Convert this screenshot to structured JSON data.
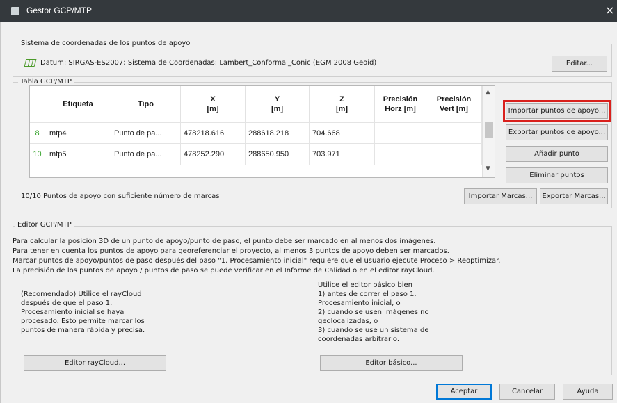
{
  "window": {
    "title": "Gestor GCP/MTP",
    "close_icon": "×"
  },
  "coord_system": {
    "group_title": "Sistema de coordenadas de los puntos de apoyo",
    "datum_text": "Datum: SIRGAS-ES2007; Sistema de Coordenadas: Lambert_Conformal_Conic (EGM 2008 Geoid)",
    "edit_button": "Editar..."
  },
  "table_group": {
    "group_title": "Tabla GCP/MTP",
    "columns": [
      {
        "line1": "",
        "line2": ""
      },
      {
        "line1": "Etiqueta",
        "line2": ""
      },
      {
        "line1": "Tipo",
        "line2": ""
      },
      {
        "line1": "X",
        "line2": "[m]"
      },
      {
        "line1": "Y",
        "line2": "[m]"
      },
      {
        "line1": "Z",
        "line2": "[m]"
      },
      {
        "line1": "Precisión",
        "line2": "Horz [m]"
      },
      {
        "line1": "Precisión",
        "line2": "Vert [m]"
      }
    ],
    "rows": [
      {
        "idx": "8",
        "label": "mtp4",
        "type": "Punto de pa...",
        "x": "478218.616",
        "y": "288618.218",
        "z": "704.668",
        "hacc": "",
        "vacc": ""
      },
      {
        "idx": "10",
        "label": "mtp5",
        "type": "Punto de pa...",
        "x": "478252.290",
        "y": "288650.950",
        "z": "703.971",
        "hacc": "",
        "vacc": ""
      }
    ],
    "side_buttons": {
      "import_points": "Importar puntos de apoyo...",
      "export_points": "Exportar puntos de apoyo...",
      "add_point": "Añadir punto",
      "remove_points": "Eliminar puntos"
    },
    "status": "10/10 Puntos de apoyo con suficiente número de marcas",
    "import_marks": "Importar Marcas...",
    "export_marks": "Exportar Marcas..."
  },
  "editor": {
    "group_title": "Editor GCP/MTP",
    "lines": [
      "Para calcular la posición 3D de un punto de apoyo/punto de paso, el punto debe ser marcado en al menos dos imágenes.",
      "Para tener en cuenta los puntos de apoyo para georeferenciar el proyecto, al menos 3 puntos de apoyo deben ser marcados.",
      "Marcar puntos de apoyo/puntos de paso después del paso \"1. Procesamiento inicial\" requiere que el usuario ejecute Proceso > Reoptimizar.",
      "La precisión de los puntos de apoyo / puntos de paso se puede verificar en el Informe de Calidad o en el editor rayCloud."
    ],
    "left_block": [
      "(Recomendado) Utilice el rayCloud",
      "después de que el paso 1.",
      "Procesamiento inicial se haya",
      "procesado. Esto permite marcar los",
      "puntos de manera rápida y precisa."
    ],
    "right_block": [
      "Utilice el editor básico bien",
      "1) antes de correr el paso 1.",
      "Procesamiento inicial, o",
      "2) cuando se usen imágenes no",
      "geolocalizadas, o",
      "3) cuando se use un sistema de",
      "coordenadas arbitrario."
    ],
    "raycloud_button": "Editor rayCloud...",
    "basic_button": "Editor básico..."
  },
  "footer": {
    "accept": "Aceptar",
    "cancel": "Cancelar",
    "help": "Ayuda"
  },
  "colors": {
    "titlebar": "#34393d",
    "highlight": "#d9201c",
    "index_green": "#3aa530",
    "primary": "#0078d7"
  },
  "icons": {
    "coord": "grid-icon",
    "close": "close-icon"
  }
}
